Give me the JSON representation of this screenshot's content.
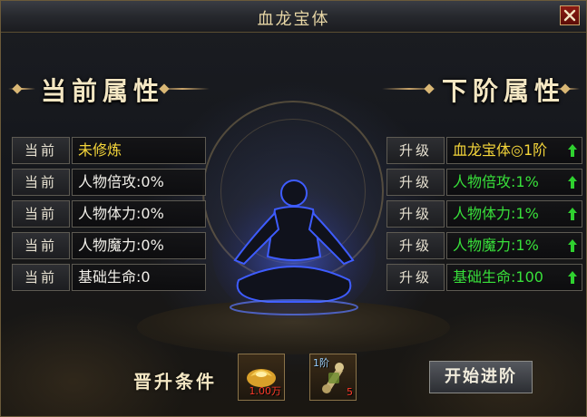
{
  "window": {
    "title": "血龙宝体"
  },
  "current": {
    "heading": "当前属性",
    "rows": [
      {
        "tag": "当前",
        "value": "未修炼"
      },
      {
        "tag": "当前",
        "value": "人物倍攻:0%"
      },
      {
        "tag": "当前",
        "value": "人物体力:0%"
      },
      {
        "tag": "当前",
        "value": "人物魔力:0%"
      },
      {
        "tag": "当前",
        "value": "基础生命:0"
      }
    ]
  },
  "next": {
    "heading": "下阶属性",
    "rows": [
      {
        "tag": "升级",
        "value": "血龙宝体◎1阶"
      },
      {
        "tag": "升级",
        "value": "人物倍攻:1%"
      },
      {
        "tag": "升级",
        "value": "人物体力:1%"
      },
      {
        "tag": "升级",
        "value": "人物魔力:1%"
      },
      {
        "tag": "升级",
        "value": "基础生命:100"
      }
    ]
  },
  "conditions": {
    "label": "晋升条件",
    "items": [
      {
        "icon": "gold-ingot-icon",
        "count": "1.00万"
      },
      {
        "icon": "bone-material-icon",
        "badge": "1阶",
        "count": "5"
      }
    ]
  },
  "actions": {
    "start_label": "开始进阶"
  },
  "colors": {
    "gold": "#c9a46a",
    "green": "#38e03a",
    "yellow": "#f5d63a",
    "close_red": "#8c1b12"
  }
}
